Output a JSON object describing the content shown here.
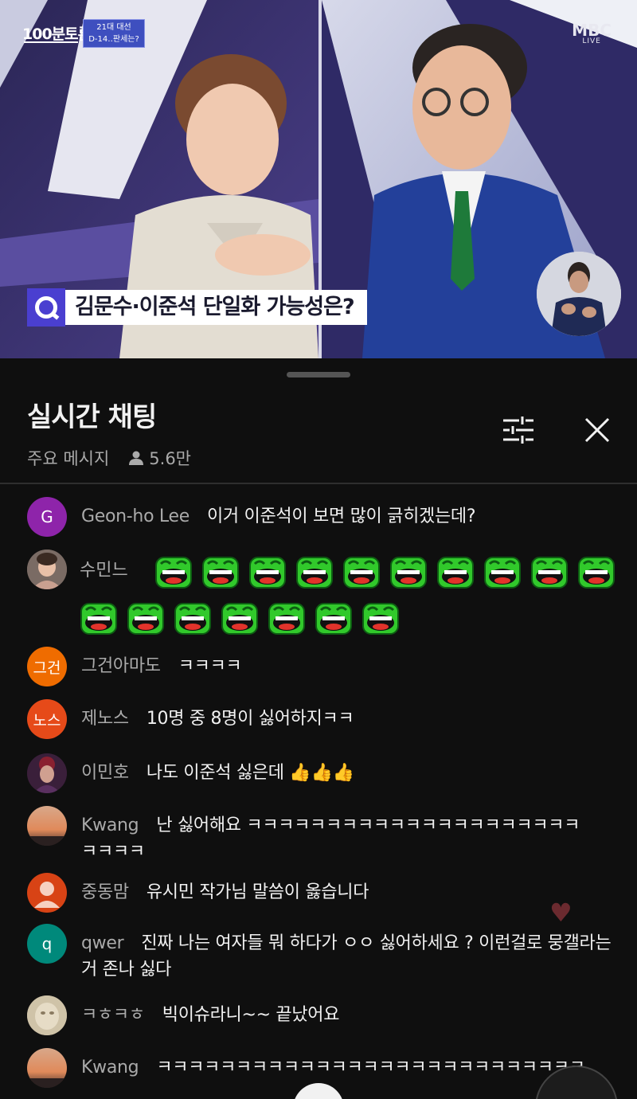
{
  "video": {
    "program_logo": "100분토론",
    "badge_line1": "21대 대선",
    "badge_line2": "D-14‥판세는?",
    "broadcaster": "MBC",
    "broadcaster_sub": "LIVE",
    "caption": "김문수·이준석 단일화 가능성은?"
  },
  "chat": {
    "title": "실시간 채팅",
    "mode": "주요 메시지",
    "viewer_count": "5.6만"
  },
  "messages": [
    {
      "author": "Geon-ho Lee",
      "text": "이거 이준석이 보면 많이 긁히겠는데?",
      "avatar_letter": "G",
      "avatar_color": "#8e24aa"
    },
    {
      "author": "수민느",
      "text": "",
      "emoji_count": 17
    },
    {
      "author": "그건아마도",
      "text": "ㅋㅋㅋㅋ",
      "avatar_letter": "그건",
      "avatar_color": "#ef6c00"
    },
    {
      "author": "제노스",
      "text": "10명 중 8명이 싫어하지ㅋㅋ",
      "avatar_letter": "노스",
      "avatar_color": "#e64a19"
    },
    {
      "author": "이민호",
      "text": "나도 이준석 싫은데 👍👍👍"
    },
    {
      "author": "Kwang",
      "text": "난 싫어해요 ㅋㅋㅋㅋㅋㅋㅋㅋㅋㅋㅋㅋㅋㅋㅋㅋㅋㅋㅋㅋㅋㅋㅋㅋㅋ"
    },
    {
      "author": "중동맘",
      "text": "유시민 작가님 말씀이 옳습니다",
      "avatar_color": "#d84315"
    },
    {
      "author": "qwer",
      "text": "진짜 나는 여자들 뭐 하다가 ㅇㅇ 싫어하세요 ? 이런걸로 뭉갤라는거 존나 싫다",
      "avatar_letter": "q",
      "avatar_color": "#00897b"
    },
    {
      "author": "ㅋㅎㅋㅎ",
      "text": "빅이슈라니~~ 끝났어요"
    },
    {
      "author": "Kwang",
      "text": "ㅋㅋㅋㅋㅋㅋㅋㅋㅋㅋㅋㅋㅋㅋㅋㅋㅋㅋㅋㅋㅋㅋㅋㅋㅋㅋㅋ"
    }
  ]
}
